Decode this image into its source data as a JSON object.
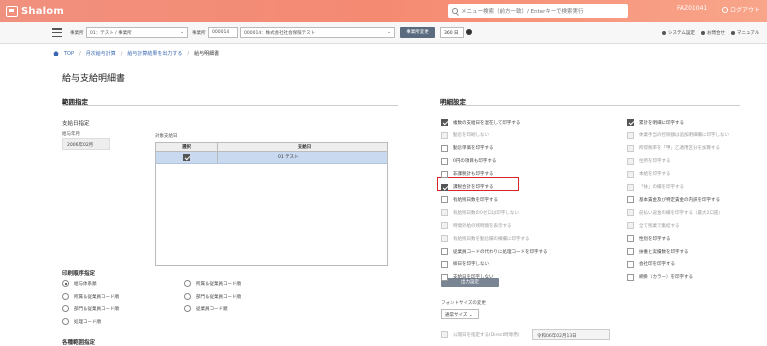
{
  "topbar": {
    "logo": "Shalom",
    "search_placeholder": "メニュー検索（前方一致）/ Enterキーで検索実行",
    "user_id": "FAZ01041",
    "logout": "ログアウト"
  },
  "toolbar": {
    "company_label": "事業所",
    "company_value": "01：テスト / 事業所",
    "office_label": "事業所",
    "office_code": "000014",
    "office_value": "000014：株式会社社会保険テスト",
    "change_button": "事業所変更",
    "number_value": "360",
    "number_suffix": "日",
    "system_settings": "システム設定",
    "help": "お問合せ",
    "manual": "マニュアル"
  },
  "breadcrumb": [
    "TOP",
    "月次給与計算",
    "給与計算結果を出力する",
    "給与明細書"
  ],
  "page_title": "給与支給明細書",
  "range": {
    "section_title": "範囲指定",
    "pay_date_title": "支給日指定",
    "year_month_label": "給与年月",
    "year_month_value": "2006年02月",
    "target_label": "対象支給日",
    "table_headers": [
      "選択",
      "支給日"
    ],
    "rows": [
      {
        "name": "01 テスト",
        "checked": true
      }
    ]
  },
  "print_order": {
    "section_title": "印刷順序指定",
    "options": [
      {
        "label": "給与体系順",
        "selected": true
      },
      {
        "label": "所属＆従業員コード順",
        "selected": false
      },
      {
        "label": "所属＆従業員コード順",
        "selected": false
      },
      {
        "label": "部門＆従業員コード順",
        "selected": false
      },
      {
        "label": "部門＆従業員コード順",
        "selected": false
      },
      {
        "label": "従業員コード順",
        "selected": false
      },
      {
        "label": "処理コード順",
        "selected": false
      }
    ],
    "next_section": "各種範囲指定"
  },
  "details": {
    "section_title": "明細設定",
    "left_options": [
      {
        "label": "複数の支給日を混在して印字する",
        "checked": true,
        "dim": false
      },
      {
        "label": "勤怠を印刷しない",
        "checked": false,
        "dim": true
      },
      {
        "label": "勤怠単価を印字する",
        "checked": false,
        "dim": false
      },
      {
        "label": "0円の項目も印字する",
        "checked": false,
        "dim": false
      },
      {
        "label": "非課税計も印字する",
        "checked": false,
        "dim": false
      },
      {
        "label": "課税合計を印字する",
        "checked": true,
        "dim": false
      },
      {
        "label": "有給残日数を印字する",
        "checked": false,
        "dim": false
      },
      {
        "label": "有給残日数の0ゼロは印字しない",
        "checked": false,
        "dim": true
      },
      {
        "label": "時間外給の残時間を表示する",
        "checked": false,
        "dim": true
      },
      {
        "label": "有給残日数を勤怠欄の横欄に印字する",
        "checked": false,
        "dim": true
      },
      {
        "label": "従業員コードの代わりに処理コードを印字する",
        "checked": false,
        "dim": false
      },
      {
        "label": "締日を印字しない",
        "checked": false,
        "dim": false
      },
      {
        "label": "支給日を印字しない",
        "checked": false,
        "dim": false
      }
    ],
    "right_options": [
      {
        "label": "累計を明細に印字する",
        "checked": true,
        "dim": false
      },
      {
        "label": "休業手当の控除額は追加明細欄に印字しない",
        "checked": false,
        "dim": true
      },
      {
        "label": "所得税率を「甲」乙適用区分を加算する",
        "checked": false,
        "dim": true
      },
      {
        "label": "住所を印字する",
        "checked": false,
        "dim": true
      },
      {
        "label": "本給を印字する",
        "checked": false,
        "dim": true
      },
      {
        "label": "「扶」の欄を印字する",
        "checked": false,
        "dim": true
      },
      {
        "label": "基本賃金及び特定賃金の内訳を印字する",
        "checked": false,
        "dim": false
      },
      {
        "label": "前払い返金の欄を印字する（最大2口座）",
        "checked": false,
        "dim": true
      },
      {
        "label": "全て残業で集結する",
        "checked": false,
        "dim": true
      },
      {
        "label": "性別を印字する",
        "checked": false,
        "dim": false
      },
      {
        "label": "扶養と実績数を印字する",
        "checked": false,
        "dim": false
      },
      {
        "label": "会社印を印字する",
        "checked": false,
        "dim": false
      },
      {
        "label": "網掛（カラー）を印字する",
        "checked": false,
        "dim": false
      }
    ],
    "output_button": "出力設定",
    "font_size_label": "フォントサイズの変更",
    "font_size_value": "通常サイズ",
    "pubdate_label": "公開日を指定する(Direct時専用)",
    "pubdate_value": "令和06年02月13日"
  }
}
